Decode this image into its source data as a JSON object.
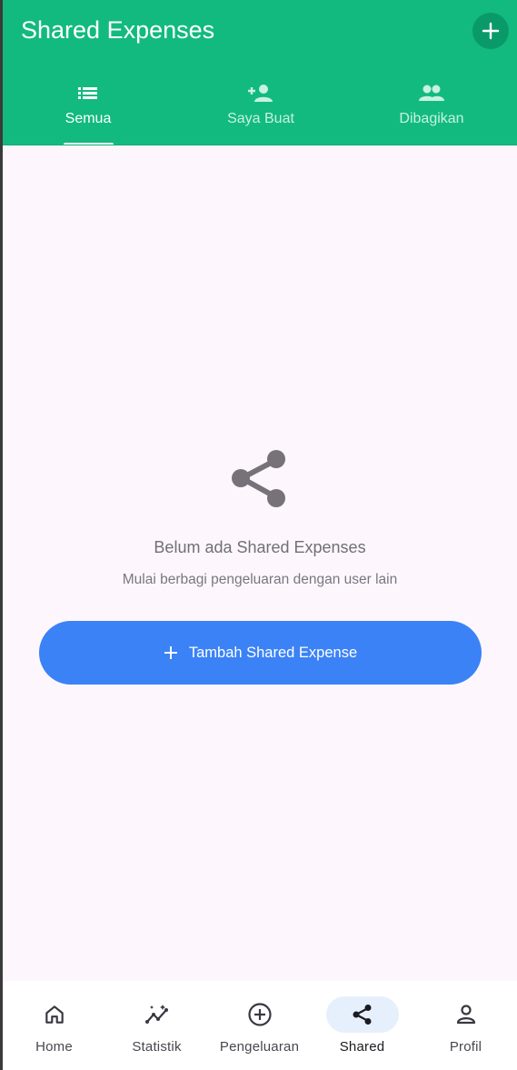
{
  "app_bar": {
    "title": "Shared Expenses",
    "action_icon": "plus-icon"
  },
  "tabs": [
    {
      "label": "Semua",
      "icon": "list-icon",
      "active": true
    },
    {
      "label": "Saya Buat",
      "icon": "person-add-icon",
      "active": false
    },
    {
      "label": "Dibagikan",
      "icon": "people-icon",
      "active": false
    }
  ],
  "empty_state": {
    "icon": "share-icon",
    "title": "Belum ada Shared Expenses",
    "subtitle": "Mulai berbagi pengeluaran dengan user lain",
    "button_label": "Tambah Shared Expense",
    "button_icon": "plus-icon"
  },
  "bottom_nav": [
    {
      "label": "Home",
      "icon": "home-icon",
      "active": false
    },
    {
      "label": "Statistik",
      "icon": "insights-icon",
      "active": false
    },
    {
      "label": "Pengeluaran",
      "icon": "add-circle-icon",
      "active": false
    },
    {
      "label": "Shared",
      "icon": "share-icon",
      "active": true
    },
    {
      "label": "Profil",
      "icon": "person-icon",
      "active": false
    }
  ],
  "colors": {
    "primary": "#12ba7f",
    "accent_button": "#3b82f6",
    "background": "#fdf7fd",
    "nav_active_pill": "#e6f0fd"
  }
}
